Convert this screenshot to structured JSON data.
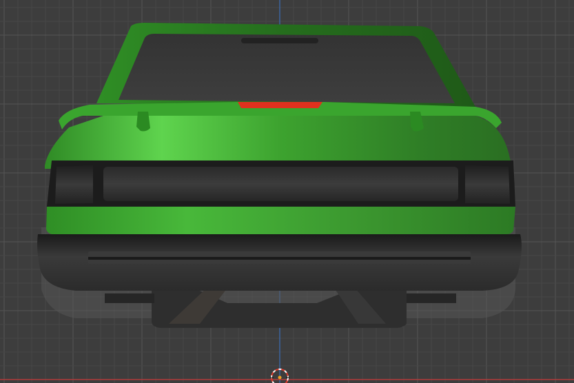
{
  "viewport": {
    "view": "back-orthographic",
    "background_color": "#3d3d3d",
    "grid_minor_color": "#474747",
    "grid_major_color": "#555555",
    "axis_vertical_color": "#3b6fb8",
    "axis_horizontal_color": "#b23b3b",
    "cursor_icon": "3d-cursor-icon"
  },
  "model": {
    "subject": "car-rear",
    "body_color": "#3aa52e",
    "body_highlight": "#63dc52",
    "trim_color": "#2a2a2a",
    "third_brake_light_color": "#e0301e"
  }
}
